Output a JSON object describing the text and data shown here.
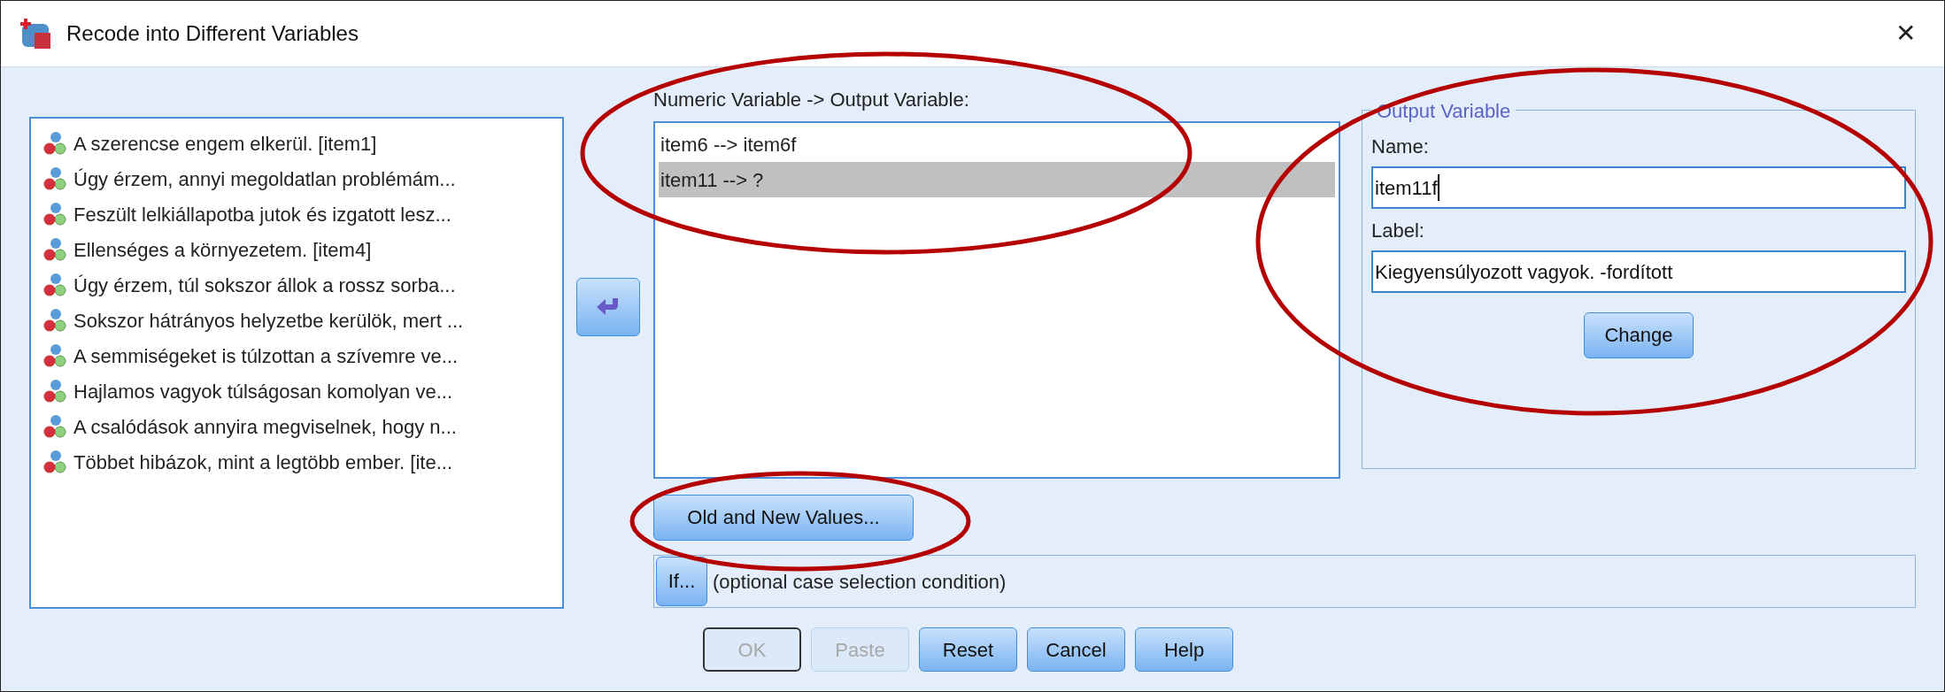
{
  "window": {
    "title": "Recode into Different Variables",
    "close": "✕"
  },
  "source_list": {
    "items": [
      {
        "label": "A szerencse engem elkerül. [item1]"
      },
      {
        "label": "Úgy érzem, annyi megoldatlan problémám..."
      },
      {
        "label": "Feszült lelkiállapotba jutok és izgatott lesz..."
      },
      {
        "label": "Ellenséges a környezetem. [item4]"
      },
      {
        "label": "Úgy érzem, túl sokszor állok a rossz sorba..."
      },
      {
        "label": "Sokszor hátrányos helyzetbe kerülök, mert ..."
      },
      {
        "label": "A semmiségeket is túlzottan a szívemre ve..."
      },
      {
        "label": "Hajlamos vagyok túlságosan komolyan ve..."
      },
      {
        "label": "A csalódások annyira megviselnek, hogy n..."
      },
      {
        "label": "Többet hibázok, mint a legtöbb ember. [ite..."
      }
    ]
  },
  "mapping": {
    "label": "Numeric Variable -> Output Variable:",
    "items": [
      {
        "label": "item6 --> item6f",
        "selected": false
      },
      {
        "label": "item11 --> ?",
        "selected": true
      }
    ]
  },
  "old_new_button": "Old and New Values...",
  "if_row": {
    "button": "If...",
    "text": "(optional case selection condition)"
  },
  "output_variable": {
    "title": "Output Variable",
    "name_label": "Name:",
    "name_value": "item11f",
    "name_focused": true,
    "label_label": "Label:",
    "label_value": "Kiegyensúlyozott vagyok. -fordított",
    "change_button": "Change"
  },
  "buttons": [
    {
      "label": "OK",
      "disabled": true,
      "default": true
    },
    {
      "label": "Paste",
      "disabled": true,
      "default": false
    },
    {
      "label": "Reset",
      "disabled": false,
      "default": false
    },
    {
      "label": "Cancel",
      "disabled": false,
      "default": false
    },
    {
      "label": "Help",
      "disabled": false,
      "default": false
    }
  ]
}
